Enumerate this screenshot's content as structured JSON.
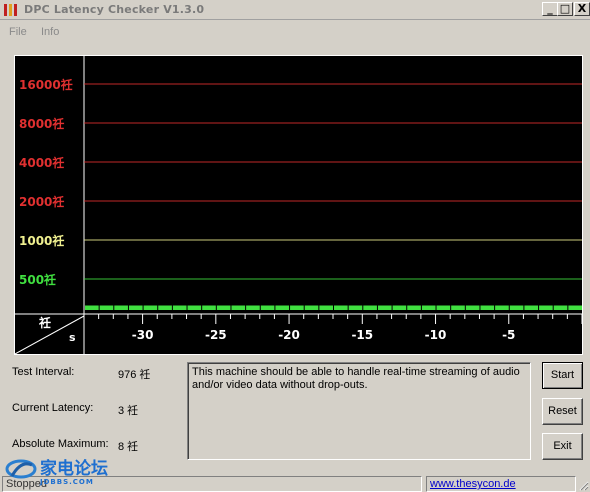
{
  "window": {
    "title": "DPC Latency Checker V1.3.0",
    "min_glyph": "_",
    "max_glyph": "□",
    "close_glyph": "X"
  },
  "menu": {
    "file": "File",
    "info": "Info"
  },
  "chart_data": {
    "type": "bar",
    "title": "",
    "y_scale": "log2",
    "y_tick_labels": [
      {
        "label": "16000祍",
        "value": 16000,
        "color": "#e03030"
      },
      {
        "label": "8000祍",
        "value": 8000,
        "color": "#e03030"
      },
      {
        "label": "4000祍",
        "value": 4000,
        "color": "#e03030"
      },
      {
        "label": "2000祍",
        "value": 2000,
        "color": "#e03030"
      },
      {
        "label": "1000祍",
        "value": 1000,
        "color": "#f0f090"
      },
      {
        "label": "500祍",
        "value": 500,
        "color": "#40e040"
      }
    ],
    "x_ticks": [
      "-30",
      "-25",
      "-20",
      "-15",
      "-10",
      "-5"
    ],
    "x_range": [
      -34,
      0
    ],
    "corner_unit_top": "祍",
    "corner_unit_bottom": "s",
    "series": [
      {
        "color": "#40e040",
        "values": [
          3,
          3,
          3,
          3,
          3,
          3,
          3,
          3,
          3,
          3,
          3,
          3,
          3,
          3,
          3,
          3,
          3,
          3,
          3,
          3,
          3,
          3,
          3,
          3,
          3,
          3,
          3,
          3,
          3,
          3,
          3,
          3,
          3,
          3
        ]
      }
    ]
  },
  "stats": {
    "test_interval_label": "Test Interval:",
    "test_interval_value": "976 祍",
    "current_latency_label": "Current Latency:",
    "current_latency_value": "3 祍",
    "absolute_maximum_label": "Absolute Maximum:",
    "absolute_maximum_value": "8 祍"
  },
  "message": "This machine should be able to handle real-time streaming of audio and/or video data without drop-outs.",
  "buttons": {
    "start": "Start",
    "reset": "Reset",
    "exit": "Exit"
  },
  "status": {
    "left": "Stopped",
    "link": "www.thesycon.de"
  },
  "watermark": {
    "brand": "家电论坛",
    "domain": "JDBBS.COM"
  }
}
